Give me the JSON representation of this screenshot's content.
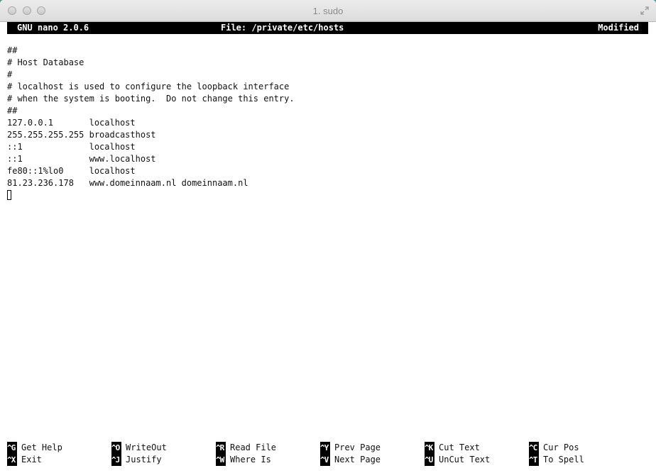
{
  "window": {
    "title": "1. sudo"
  },
  "nano": {
    "version": "GNU nano 2.0.6",
    "file": "File: /private/etc/hosts",
    "status": "Modified"
  },
  "buffer": {
    "lines": [
      "",
      "##",
      "# Host Database",
      "#",
      "# localhost is used to configure the loopback interface",
      "# when the system is booting.  Do not change this entry.",
      "##",
      "127.0.0.1       localhost",
      "255.255.255.255 broadcasthost",
      "::1             localhost",
      "::1             www.localhost",
      "fe80::1%lo0     localhost",
      "81.23.236.178   www.domeinnaam.nl domeinnaam.nl"
    ]
  },
  "shortcuts": {
    "row1": [
      {
        "key": "^G",
        "label": "Get Help"
      },
      {
        "key": "^O",
        "label": "WriteOut"
      },
      {
        "key": "^R",
        "label": "Read File"
      },
      {
        "key": "^Y",
        "label": "Prev Page"
      },
      {
        "key": "^K",
        "label": "Cut Text"
      },
      {
        "key": "^C",
        "label": "Cur Pos"
      }
    ],
    "row2": [
      {
        "key": "^X",
        "label": "Exit"
      },
      {
        "key": "^J",
        "label": "Justify"
      },
      {
        "key": "^W",
        "label": "Where Is"
      },
      {
        "key": "^V",
        "label": "Next Page"
      },
      {
        "key": "^U",
        "label": "UnCut Text"
      },
      {
        "key": "^T",
        "label": "To Spell"
      }
    ]
  }
}
